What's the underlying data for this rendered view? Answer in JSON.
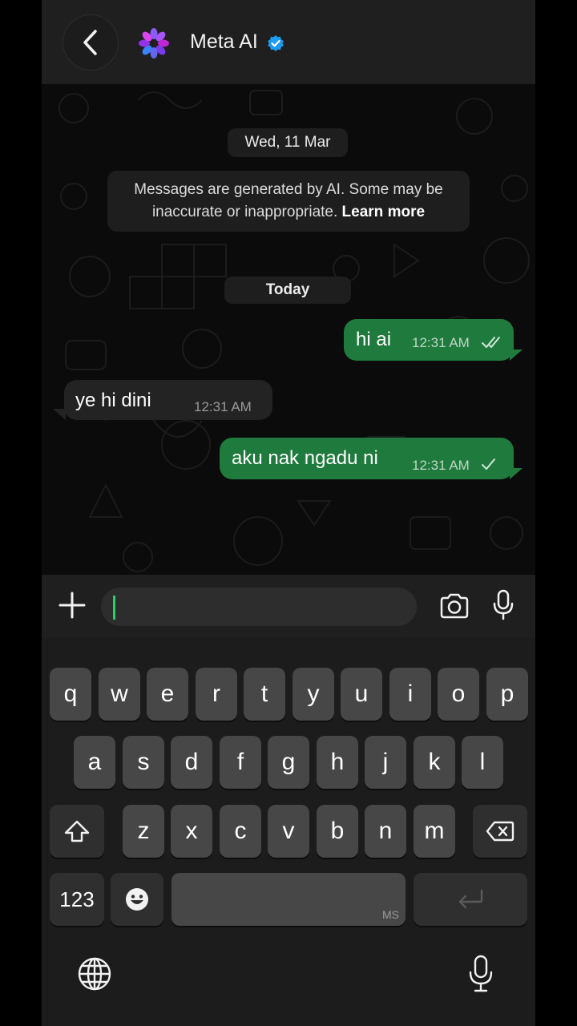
{
  "header": {
    "title": "Meta AI",
    "back_icon": "chevron-left-icon",
    "avatar_icon": "meta-ai-logo",
    "verified_icon": "verified-badge-icon"
  },
  "chat": {
    "date_separator": "Wed, 11 Mar",
    "notice_text": "Messages are generated by AI. Some may be inaccurate or inappropriate.",
    "notice_link": "Learn more",
    "today_separator": "Today",
    "messages": [
      {
        "direction": "outgoing",
        "text": "hi ai",
        "time": "12:31 AM",
        "status": "read"
      },
      {
        "direction": "incoming",
        "text": "ye hi dini",
        "time": "12:31 AM"
      },
      {
        "direction": "outgoing",
        "text": "aku nak ngadu ni",
        "time": "12:31 AM",
        "status": "sent"
      }
    ]
  },
  "input_bar": {
    "value": "",
    "icons": [
      "plus-icon",
      "camera-icon",
      "microphone-icon"
    ]
  },
  "keyboard": {
    "row1": [
      "q",
      "w",
      "e",
      "r",
      "t",
      "y",
      "u",
      "i",
      "o",
      "p"
    ],
    "row2": [
      "a",
      "s",
      "d",
      "f",
      "g",
      "h",
      "j",
      "k",
      "l"
    ],
    "row3": [
      "z",
      "x",
      "c",
      "v",
      "b",
      "n",
      "m"
    ],
    "numbers_key": "123",
    "space_brand": "MS",
    "icons": [
      "shift-icon",
      "backspace-icon",
      "emoji-icon",
      "return-icon",
      "globe-icon",
      "dictation-icon"
    ]
  },
  "colors": {
    "outgoing_bubble": "#1f7a3d",
    "incoming_bubble": "#232323",
    "verified_blue": "#1d9bf0",
    "caret_green": "#25d366"
  }
}
